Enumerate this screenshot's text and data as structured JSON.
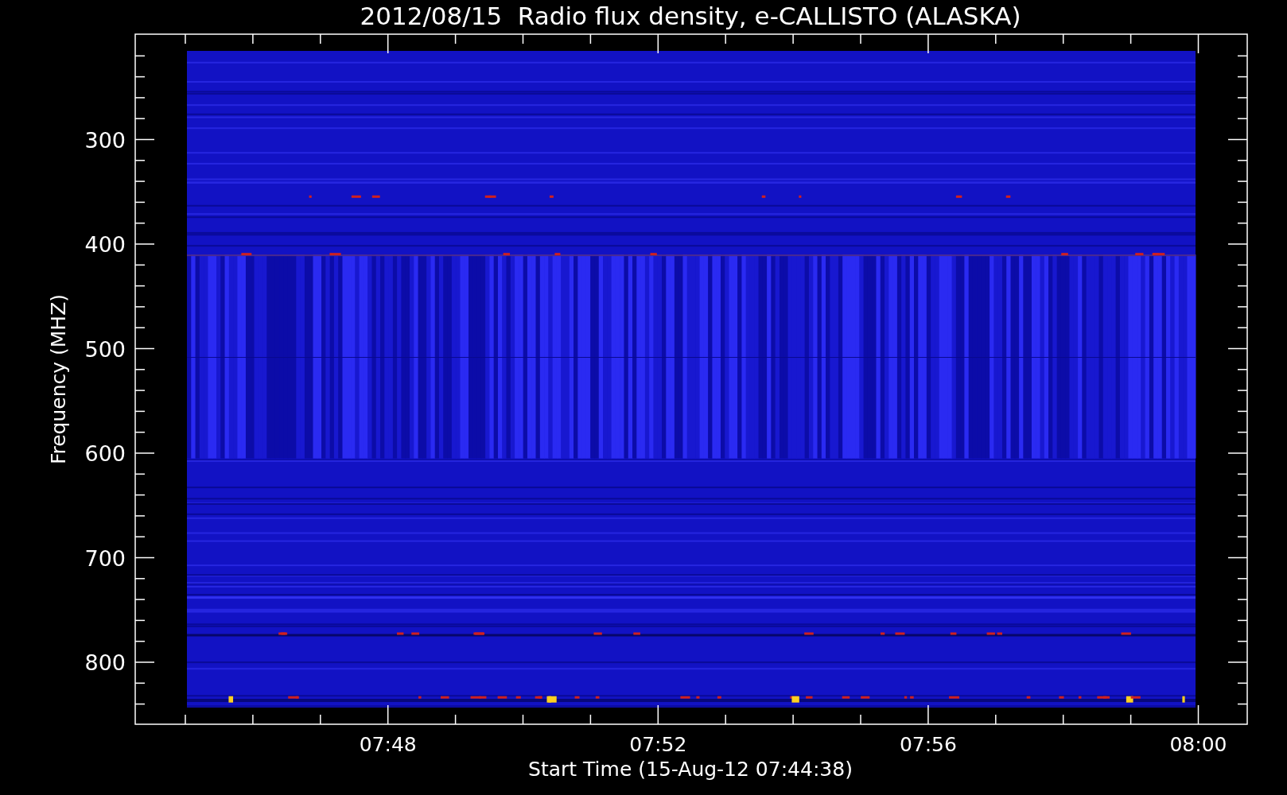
{
  "title": "2012/08/15  Radio flux density, e-CALLISTO (ALASKA)",
  "y_axis": {
    "title": "Frequency (MHZ)",
    "ticks": [
      "300",
      "400",
      "500",
      "600",
      "700",
      "800"
    ]
  },
  "x_axis": {
    "title": "Start Time (15-Aug-12 07:44:38)",
    "ticks": [
      "07:48",
      "07:52",
      "07:56",
      "08:00"
    ]
  }
}
